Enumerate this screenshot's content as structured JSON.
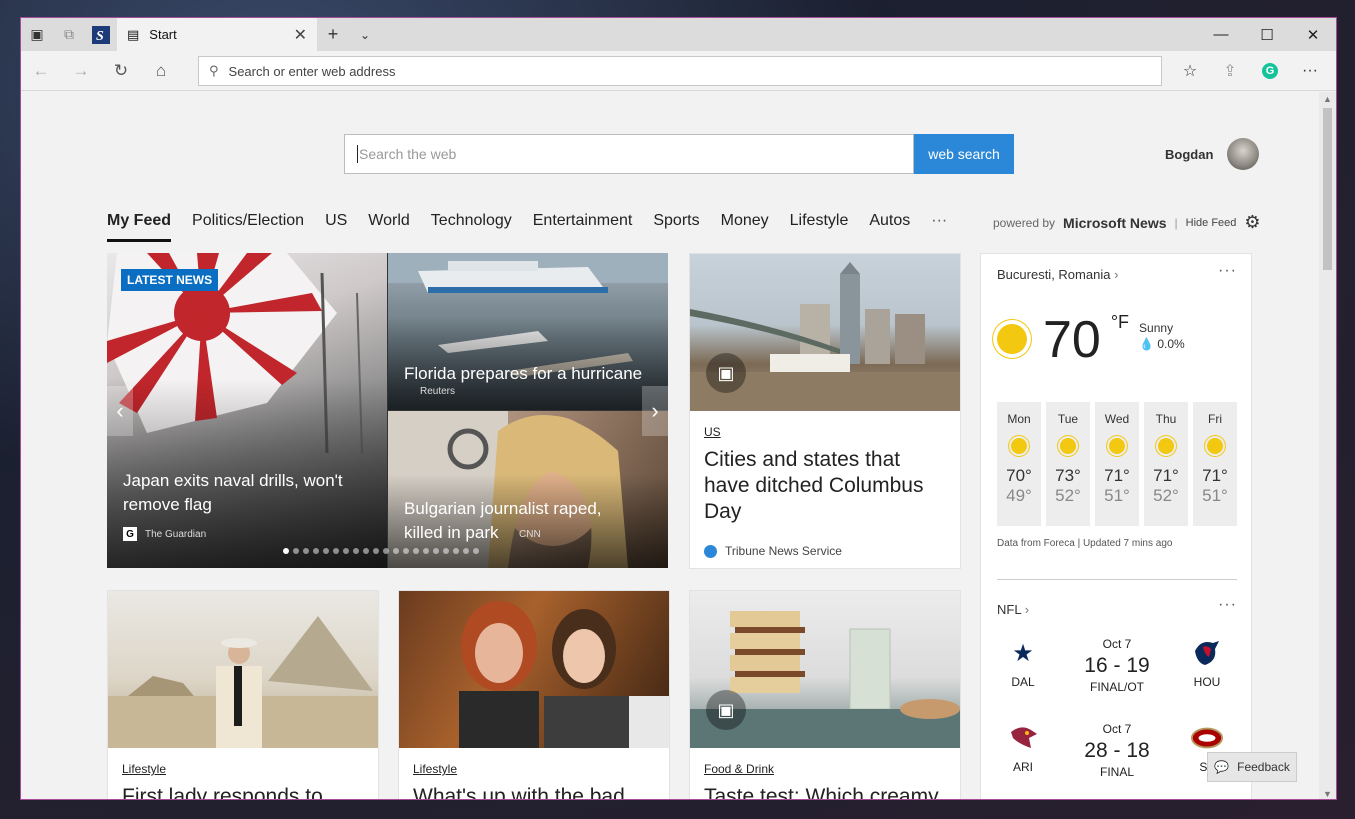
{
  "browser": {
    "tab_title": "Start",
    "address_placeholder": "Search or enter web address"
  },
  "search": {
    "placeholder": "Search the web",
    "button": "web search"
  },
  "user": {
    "name": "Bogdan"
  },
  "feed_nav": [
    "My Feed",
    "Politics/Election",
    "US",
    "World",
    "Technology",
    "Entertainment",
    "Sports",
    "Money",
    "Lifestyle",
    "Autos",
    "···"
  ],
  "powered": {
    "prefix": "powered by",
    "brand": "Microsoft News",
    "hide": "Hide Feed"
  },
  "hero": {
    "badge": "LATEST NEWS",
    "main_title": "Japan exits naval drills, won't remove flag",
    "main_source": "The Guardian",
    "tr_title": "Florida prepares for a hurricane",
    "tr_source": "Reuters",
    "br_title": "Bulgarian journalist raped, killed in park",
    "br_source": "CNN",
    "slide_count": 20,
    "active_slide": 1
  },
  "cards": {
    "columbus": {
      "category": "US",
      "title": "Cities and states that have ditched Columbus Day",
      "source": "Tribune News Service"
    },
    "first_lady": {
      "category": "Lifestyle",
      "title": "First lady responds to"
    },
    "whats_up": {
      "category": "Lifestyle",
      "title": "What's up with the bad"
    },
    "taste": {
      "category": "Food & Drink",
      "title": "Taste test: Which creamy"
    }
  },
  "weather": {
    "location": "Bucuresti, Romania",
    "temp": "70",
    "unit": "°F",
    "condition": "Sunny",
    "precip": "0.0%",
    "days": [
      {
        "name": "Mon",
        "hi": "70°",
        "lo": "49°"
      },
      {
        "name": "Tue",
        "hi": "73°",
        "lo": "52°"
      },
      {
        "name": "Wed",
        "hi": "71°",
        "lo": "51°"
      },
      {
        "name": "Thu",
        "hi": "71°",
        "lo": "52°"
      },
      {
        "name": "Fri",
        "hi": "71°",
        "lo": "51°"
      }
    ],
    "footer": "Data from Foreca | Updated 7 mins ago"
  },
  "nfl": {
    "label": "NFL",
    "games": [
      {
        "date": "Oct 7",
        "score": "16 - 19",
        "status": "FINAL/OT",
        "home": "DAL",
        "away": "HOU"
      },
      {
        "date": "Oct 7",
        "score": "28 - 18",
        "status": "FINAL",
        "home": "ARI",
        "away": "SF"
      }
    ]
  },
  "feedback": "Feedback"
}
